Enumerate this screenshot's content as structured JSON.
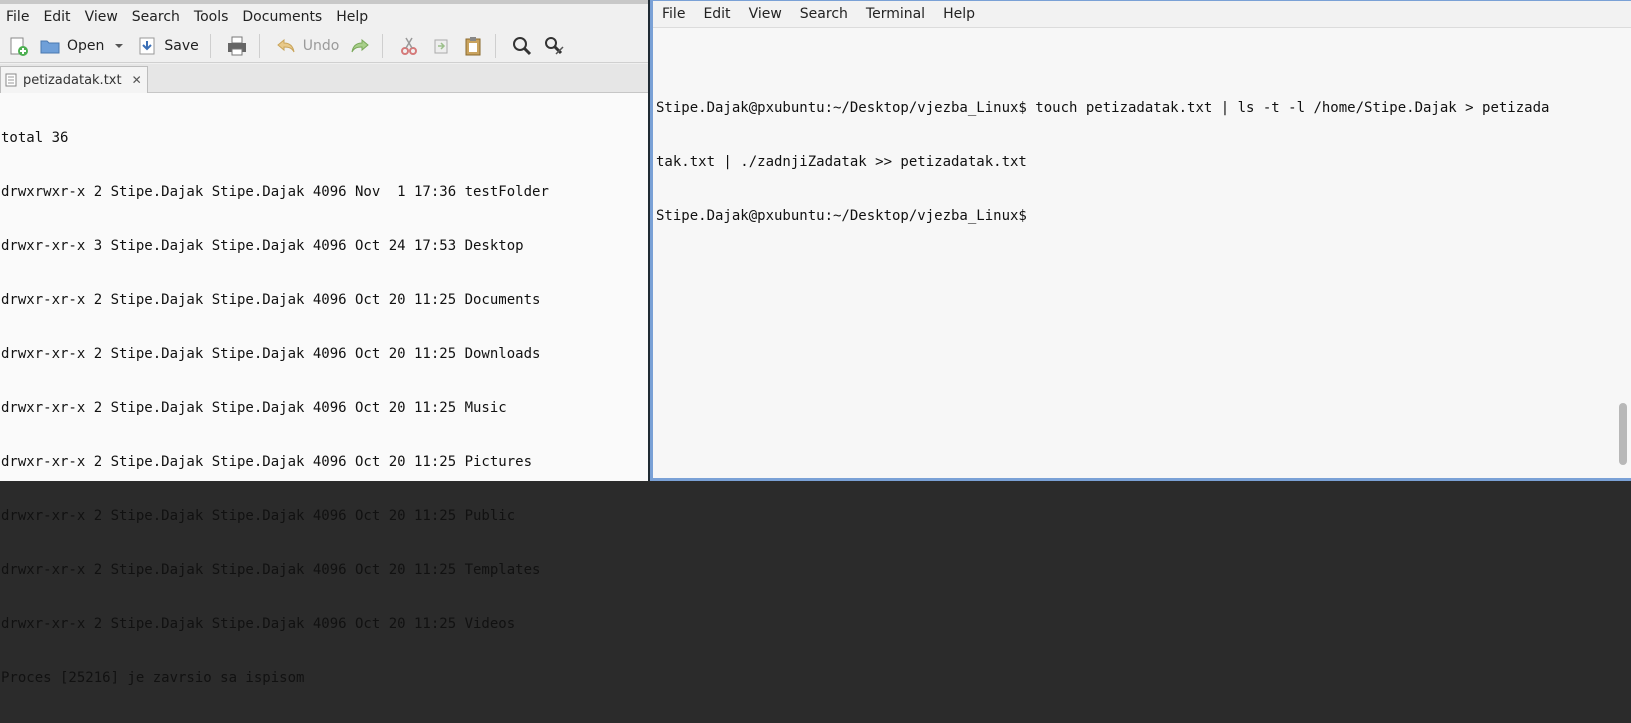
{
  "editor": {
    "menu": [
      "File",
      "Edit",
      "View",
      "Search",
      "Tools",
      "Documents",
      "Help"
    ],
    "toolbar": {
      "new_icon": "new-document-icon",
      "open_label": "Open",
      "save_label": "Save",
      "undo_label": "Undo"
    },
    "tab": {
      "label": "petizadatak.txt",
      "close": "✕"
    },
    "lines": [
      "total 36",
      "drwxrwxr-x 2 Stipe.Dajak Stipe.Dajak 4096 Nov  1 17:36 testFolder",
      "drwxr-xr-x 3 Stipe.Dajak Stipe.Dajak 4096 Oct 24 17:53 Desktop",
      "drwxr-xr-x 2 Stipe.Dajak Stipe.Dajak 4096 Oct 20 11:25 Documents",
      "drwxr-xr-x 2 Stipe.Dajak Stipe.Dajak 4096 Oct 20 11:25 Downloads",
      "drwxr-xr-x 2 Stipe.Dajak Stipe.Dajak 4096 Oct 20 11:25 Music",
      "drwxr-xr-x 2 Stipe.Dajak Stipe.Dajak 4096 Oct 20 11:25 Pictures",
      "drwxr-xr-x 2 Stipe.Dajak Stipe.Dajak 4096 Oct 20 11:25 Public",
      "drwxr-xr-x 2 Stipe.Dajak Stipe.Dajak 4096 Oct 20 11:25 Templates",
      "drwxr-xr-x 2 Stipe.Dajak Stipe.Dajak 4096 Oct 20 11:25 Videos",
      "Proces [25216] je zavrsio sa ispisom"
    ]
  },
  "terminal": {
    "menu": [
      "File",
      "Edit",
      "View",
      "Search",
      "Terminal",
      "Help"
    ],
    "lines": [
      "Stipe.Dajak@pxubuntu:~/Desktop/vjezba_Linux$ touch petizadatak.txt | ls -t -l /home/Stipe.Dajak > petizada",
      "tak.txt | ./zadnjiZadatak >> petizadatak.txt",
      "Stipe.Dajak@pxubuntu:~/Desktop/vjezba_Linux$"
    ]
  },
  "colors": {
    "terminal_border": "#7aa1d6",
    "editor_bg": "#fafafa",
    "terminal_bg": "#f7f7f7"
  }
}
